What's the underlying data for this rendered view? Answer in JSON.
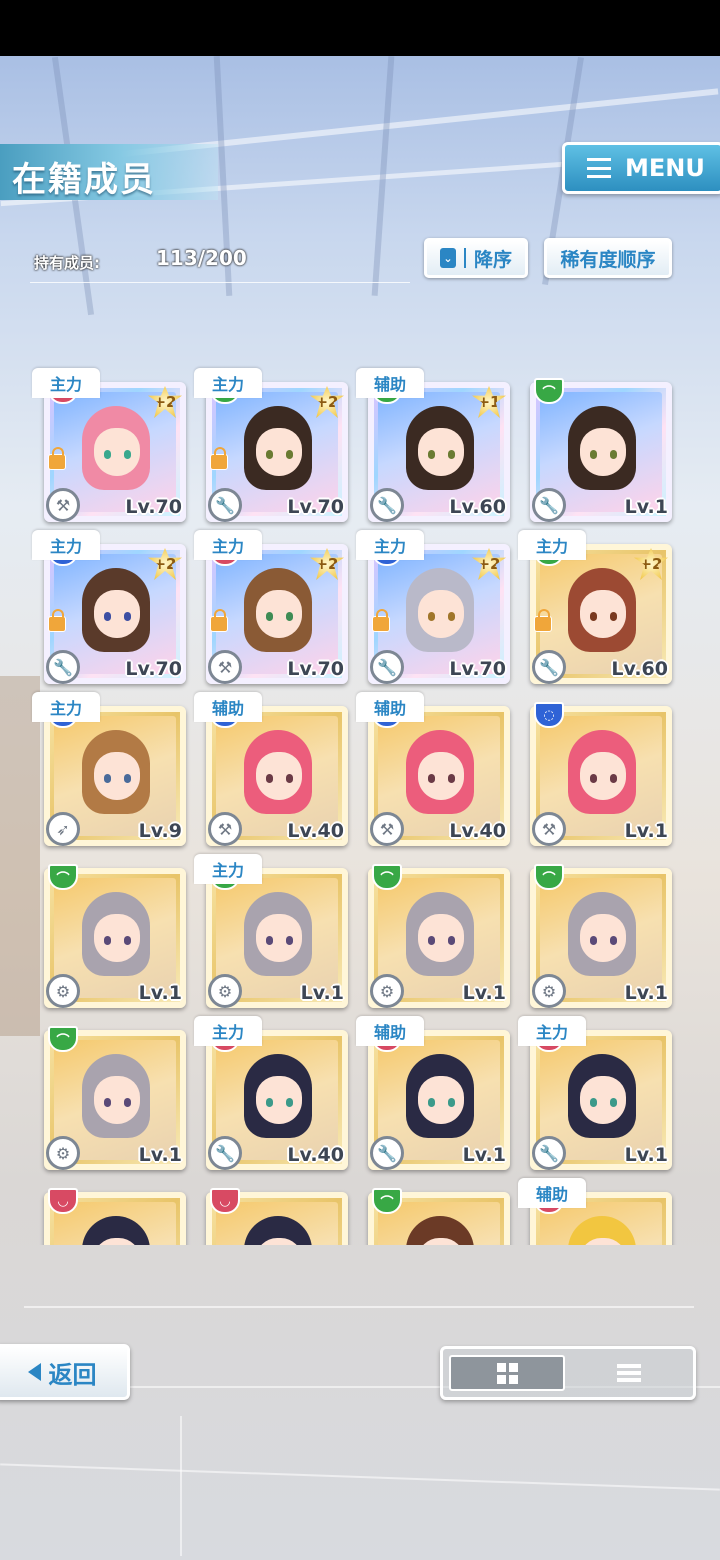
{
  "header": {
    "title": "在籍成员",
    "menu_label": "MENU",
    "members_label": "持有成员:",
    "members_count": "113/200",
    "sort_order_label": "降序",
    "sort_key_label": "稀有度顺序"
  },
  "colors": {
    "accent": "#2b86c4",
    "attr_red": "#d84a63",
    "attr_green": "#38a845",
    "attr_blue": "#2f63d6"
  },
  "cards": [
    {
      "role": "主力",
      "attr": "red",
      "rarity": "rainbow",
      "plus": "+2",
      "locked": true,
      "tool": "hammer",
      "level": "Lv.70",
      "hair": "#f08aa5",
      "eyes": "#3aa88d"
    },
    {
      "role": "主力",
      "attr": "green",
      "rarity": "rainbow",
      "plus": "+2",
      "locked": true,
      "tool": "wrench",
      "level": "Lv.70",
      "hair": "#3b2a22",
      "eyes": "#6a7b32"
    },
    {
      "role": "辅助",
      "attr": "green",
      "rarity": "rainbow",
      "plus": "+1",
      "locked": false,
      "tool": "wrench",
      "level": "Lv.60",
      "hair": "#3b2a22",
      "eyes": "#6a7b32"
    },
    {
      "role": "",
      "attr": "green",
      "rarity": "rainbow",
      "plus": "",
      "locked": false,
      "tool": "wrench",
      "level": "Lv.1",
      "hair": "#3b2a22",
      "eyes": "#6a7b32"
    },
    {
      "role": "主力",
      "attr": "blue",
      "rarity": "rainbow",
      "plus": "+2",
      "locked": true,
      "tool": "wrench",
      "level": "Lv.70",
      "hair": "#5a3a2a",
      "eyes": "#3d4fa3"
    },
    {
      "role": "主力",
      "attr": "red",
      "rarity": "rainbow",
      "plus": "+2",
      "locked": true,
      "tool": "hammer",
      "level": "Lv.70",
      "hair": "#8a5a35",
      "eyes": "#3f8c55"
    },
    {
      "role": "主力",
      "attr": "blue",
      "rarity": "rainbow",
      "plus": "+2",
      "locked": true,
      "tool": "wrench",
      "level": "Lv.70",
      "hair": "#b9b9c9",
      "eyes": "#a0762a"
    },
    {
      "role": "主力",
      "attr": "green",
      "rarity": "gold",
      "plus": "+2",
      "locked": true,
      "tool": "wrench",
      "level": "Lv.60",
      "hair": "#9c4a33",
      "eyes": "#7a3a20"
    },
    {
      "role": "主力",
      "attr": "blue",
      "rarity": "gold",
      "plus": "",
      "locked": false,
      "tool": "rocket",
      "level": "Lv.9",
      "hair": "#b27a45",
      "eyes": "#4a6b9a"
    },
    {
      "role": "辅助",
      "attr": "blue",
      "rarity": "gold",
      "plus": "",
      "locked": false,
      "tool": "hammer",
      "level": "Lv.40",
      "hair": "#ec5d7c",
      "eyes": "#6b3a46"
    },
    {
      "role": "辅助",
      "attr": "blue",
      "rarity": "gold",
      "plus": "",
      "locked": false,
      "tool": "hammer",
      "level": "Lv.40",
      "hair": "#ec5d7c",
      "eyes": "#6b3a46"
    },
    {
      "role": "",
      "attr": "blue",
      "rarity": "gold",
      "plus": "",
      "locked": false,
      "tool": "hammer",
      "level": "Lv.1",
      "hair": "#ec5d7c",
      "eyes": "#6b3a46"
    },
    {
      "role": "",
      "attr": "green",
      "rarity": "gold",
      "plus": "",
      "locked": false,
      "tool": "gear",
      "level": "Lv.1",
      "hair": "#a9a3ae",
      "eyes": "#5b4a78"
    },
    {
      "role": "主力",
      "attr": "green",
      "rarity": "gold",
      "plus": "",
      "locked": false,
      "tool": "gear",
      "level": "Lv.1",
      "hair": "#a9a3ae",
      "eyes": "#5b4a78"
    },
    {
      "role": "",
      "attr": "green",
      "rarity": "gold",
      "plus": "",
      "locked": false,
      "tool": "gear",
      "level": "Lv.1",
      "hair": "#a9a3ae",
      "eyes": "#5b4a78"
    },
    {
      "role": "",
      "attr": "green",
      "rarity": "gold",
      "plus": "",
      "locked": false,
      "tool": "gear",
      "level": "Lv.1",
      "hair": "#a9a3ae",
      "eyes": "#5b4a78"
    },
    {
      "role": "",
      "attr": "green",
      "rarity": "gold",
      "plus": "",
      "locked": false,
      "tool": "gear",
      "level": "Lv.1",
      "hair": "#a9a3ae",
      "eyes": "#5b4a78"
    },
    {
      "role": "主力",
      "attr": "red",
      "rarity": "gold",
      "plus": "",
      "locked": false,
      "tool": "wrench",
      "level": "Lv.40",
      "hair": "#2a2a44",
      "eyes": "#3c9a8a"
    },
    {
      "role": "辅助",
      "attr": "red",
      "rarity": "gold",
      "plus": "",
      "locked": false,
      "tool": "wrench",
      "level": "Lv.1",
      "hair": "#2a2a44",
      "eyes": "#3c9a8a"
    },
    {
      "role": "主力",
      "attr": "red",
      "rarity": "gold",
      "plus": "",
      "locked": false,
      "tool": "wrench",
      "level": "Lv.1",
      "hair": "#2a2a44",
      "eyes": "#3c9a8a"
    },
    {
      "role": "",
      "attr": "red",
      "rarity": "gold",
      "plus": "",
      "locked": false,
      "tool": "",
      "level": "",
      "hair": "#2a2a44",
      "eyes": "#3c9a8a"
    },
    {
      "role": "",
      "attr": "red",
      "rarity": "gold",
      "plus": "",
      "locked": false,
      "tool": "",
      "level": "",
      "hair": "#2a2a44",
      "eyes": "#3c9a8a"
    },
    {
      "role": "",
      "attr": "green",
      "rarity": "gold",
      "plus": "",
      "locked": false,
      "tool": "",
      "level": "",
      "hair": "#6b3a26",
      "eyes": "#5a3a2a"
    },
    {
      "role": "辅助",
      "attr": "red",
      "rarity": "gold",
      "plus": "",
      "locked": false,
      "tool": "",
      "level": "",
      "hair": "#f2c640",
      "eyes": "#8a4ab0"
    }
  ],
  "footer": {
    "back_label": "返回",
    "view_mode": "grid"
  }
}
